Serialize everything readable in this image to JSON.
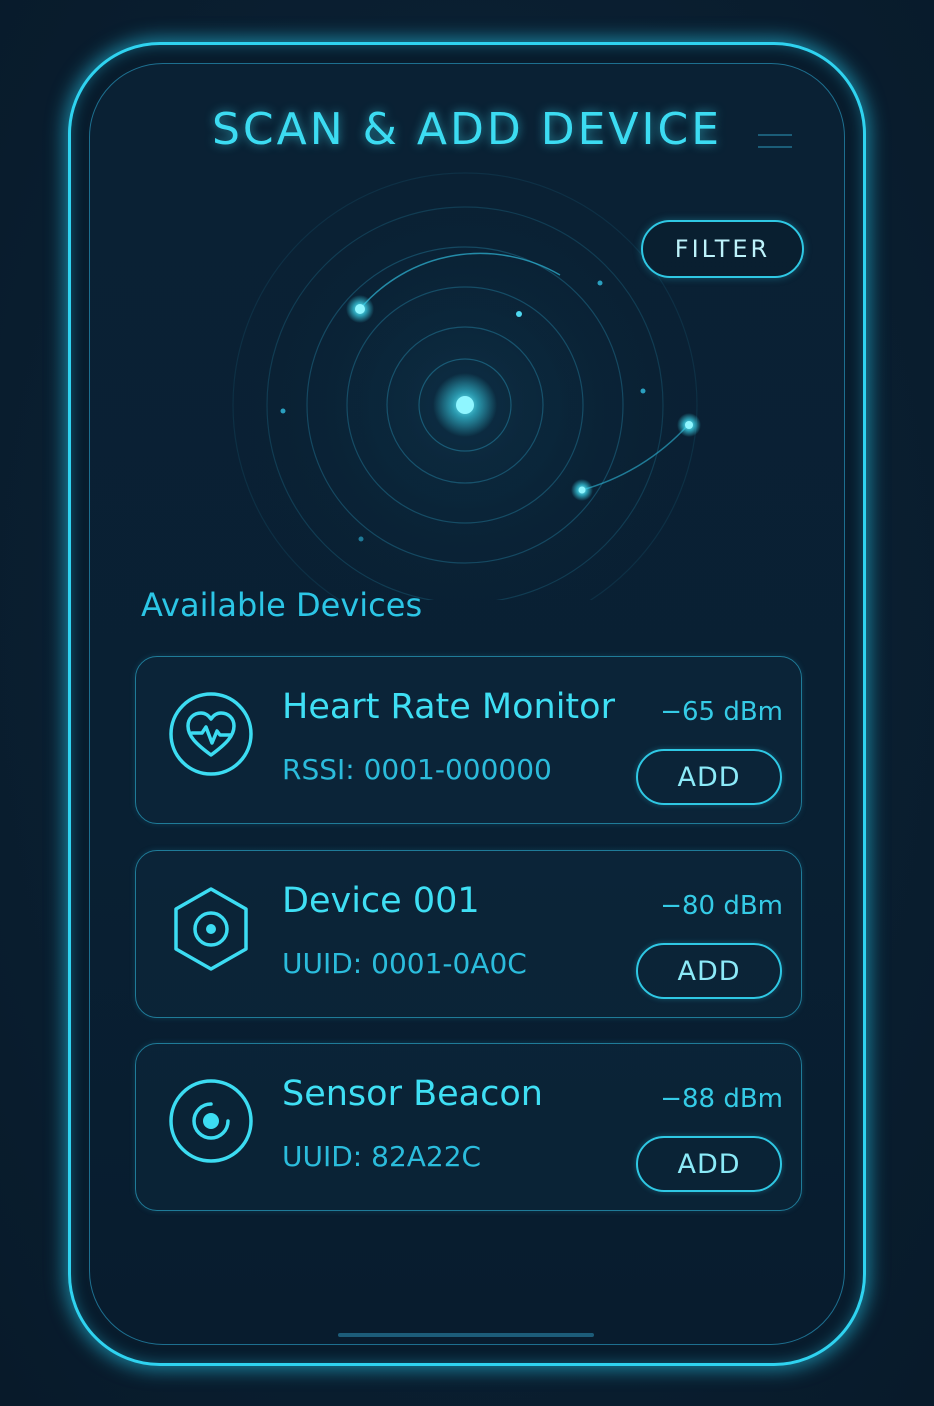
{
  "header": {
    "title": "SCAN & ADD DEVICE",
    "menu_icon": "menu-icon",
    "filter_label": "FILTER"
  },
  "radar": {
    "icon": "radar-scan",
    "accent_color": "#3cdcf2"
  },
  "devices_section": {
    "label": "Available Devices",
    "items": [
      {
        "name": "Heart Rate Monitor",
        "identifier": "RSSI: 0001-000000",
        "signal": "−65 dBm",
        "icon": "heart-rate-icon",
        "action_label": "ADD"
      },
      {
        "name": "Device 001",
        "identifier": "UUID: 0001-0A0C",
        "signal": "−80 dBm",
        "icon": "hexagon-device-icon",
        "action_label": "ADD"
      },
      {
        "name": "Sensor Beacon",
        "identifier": "UUID: 82A22C",
        "signal": "−88 dBm",
        "icon": "beacon-icon",
        "action_label": "ADD"
      }
    ]
  },
  "colors": {
    "background": "#0a2033",
    "accent": "#2fd3f0",
    "text_primary": "#3fdff4",
    "text_secondary": "#2bbcdc"
  }
}
